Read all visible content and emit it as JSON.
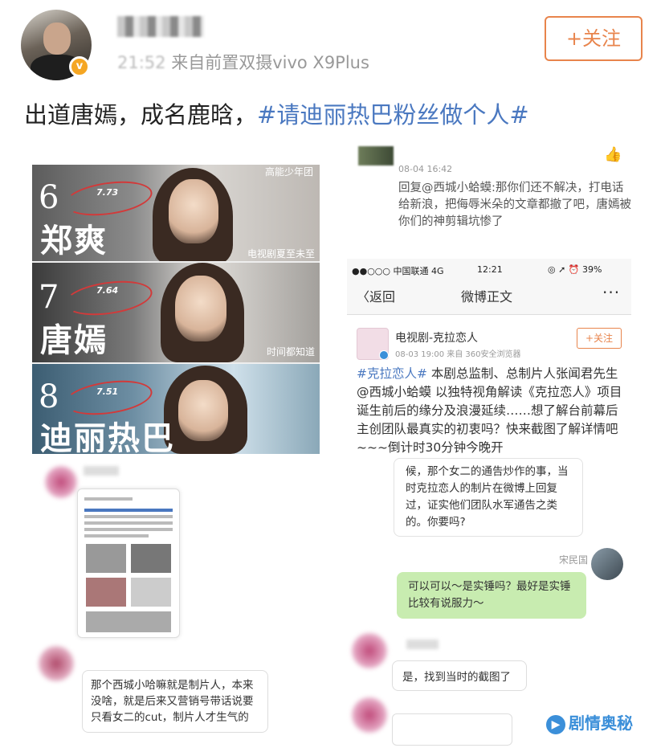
{
  "post": {
    "meta_time": "21:52",
    "meta_source": "来自前置双摄vivo X9Plus",
    "follow_label": "+关注",
    "text_plain": "出道唐嫣，成名鹿晗，",
    "text_tag": "#请迪丽热巴粉丝做个人#"
  },
  "ranking": {
    "top_label": "高能少年团",
    "items": [
      {
        "rank": "6",
        "name": "郑爽",
        "score": "7.73",
        "caption": "电视剧夏至未至"
      },
      {
        "rank": "7",
        "name": "唐嫣",
        "score": "7.64",
        "caption": "时间都知道"
      },
      {
        "rank": "8",
        "name": "迪丽热巴",
        "score": "7.51",
        "caption": ""
      }
    ]
  },
  "reply": {
    "date": "08-04 16:42",
    "text": "回复@西城小蛤蟆:那你们还不解决，打电话给新浪，把侮辱米朵的文章都撤了吧，唐嫣被你们的神剪辑坑惨了"
  },
  "phone": {
    "carrier": "●●○○○ 中国联通  4G",
    "time": "12:21",
    "battery": "◎ ➚ ⏰ 39%",
    "back_label": "〈返回",
    "title": "微博正文",
    "more": "···",
    "account_name": "电视剧-克拉恋人",
    "account_meta": "08-03 19:00  来自 360安全浏览器",
    "follow_label": "+关注",
    "body_tag": "#克拉恋人#",
    "body_text": " 本剧总监制、总制片人张闻君先生@西城小蛤蟆 以独特视角解读《克拉恋人》项目诞生前后的缘分及浪漫延续……想了解台前幕后主创团队最真实的初衷吗？快来截图了解详情吧~~~倒计时30分钟今晚开"
  },
  "chat_left": {
    "bubble": "那个西城小哈嘛就是制片人，本来没啥，就是后来又营销号带话说要只看女二的cut，制片人才生气的"
  },
  "chat_right": {
    "bubble1": "候，那个女二的通告炒作的事，当时克拉恋人的制片在微博上回复过，证实他们团队水军通告之类的。你要吗?",
    "sender_name": "宋民国",
    "bubble_green": "可以可以～是实锤吗？最好是实锤比较有说服力～",
    "bubble3": "是，找到当时的截图了"
  },
  "watermark": {
    "text": "剧情奥秘"
  },
  "colors": {
    "follow_orange": "#e8844c",
    "link_blue": "#4a78c0",
    "wechat_green": "#c8ecb0",
    "watermark_blue": "#3b8fd9"
  }
}
